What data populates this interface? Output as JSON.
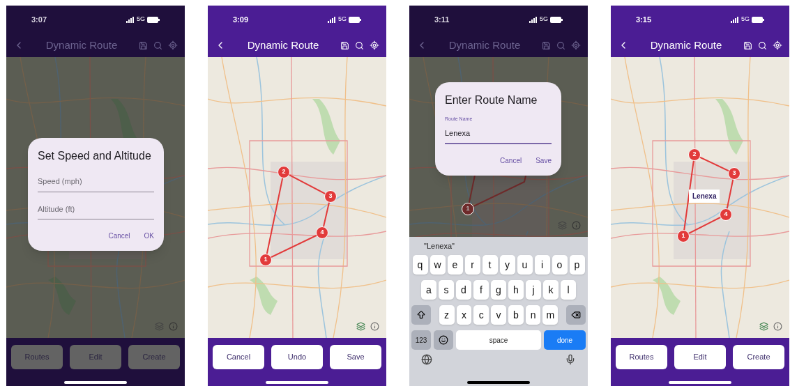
{
  "phones": [
    {
      "time": "3:07",
      "network": "5G",
      "title": "Dynamic Route",
      "dimmed": true,
      "dialog": {
        "title": "Set Speed and Altitude",
        "fields": [
          {
            "placeholder": "Speed (mph)",
            "focused": false
          },
          {
            "placeholder": "Altitude (ft)",
            "focused": false
          }
        ],
        "buttons": [
          "Cancel",
          "OK"
        ]
      },
      "bottom_buttons": [
        "Routes",
        "Edit",
        "Create"
      ]
    },
    {
      "time": "3:09",
      "network": "5G",
      "title": "Dynamic Route",
      "dimmed": false,
      "markers": [
        "1",
        "2",
        "3",
        "4"
      ],
      "bottom_buttons": [
        "Cancel",
        "Undo",
        "Save"
      ]
    },
    {
      "time": "3:11",
      "network": "5G",
      "title": "Dynamic Route",
      "dimmed": true,
      "markers": [
        "1"
      ],
      "dialog": {
        "title": "Enter Route Name",
        "fields": [
          {
            "label": "Route Name",
            "value": "Lenexa",
            "focused": true
          }
        ],
        "buttons": [
          "Cancel",
          "Save"
        ]
      },
      "keyboard": {
        "suggestion": "\"Lenexa\"",
        "rows": [
          [
            "q",
            "w",
            "e",
            "r",
            "t",
            "y",
            "u",
            "i",
            "o",
            "p"
          ],
          [
            "a",
            "s",
            "d",
            "f",
            "g",
            "h",
            "j",
            "k",
            "l"
          ],
          [
            "z",
            "x",
            "c",
            "v",
            "b",
            "n",
            "m"
          ]
        ],
        "mode_key": "123",
        "space_key": "space",
        "return_key": "done"
      }
    },
    {
      "time": "3:15",
      "network": "5G",
      "title": "Dynamic Route",
      "dimmed": false,
      "markers": [
        "1",
        "2",
        "3",
        "4"
      ],
      "route_label": "Lenexa",
      "bottom_buttons": [
        "Routes",
        "Edit",
        "Create"
      ]
    }
  ]
}
